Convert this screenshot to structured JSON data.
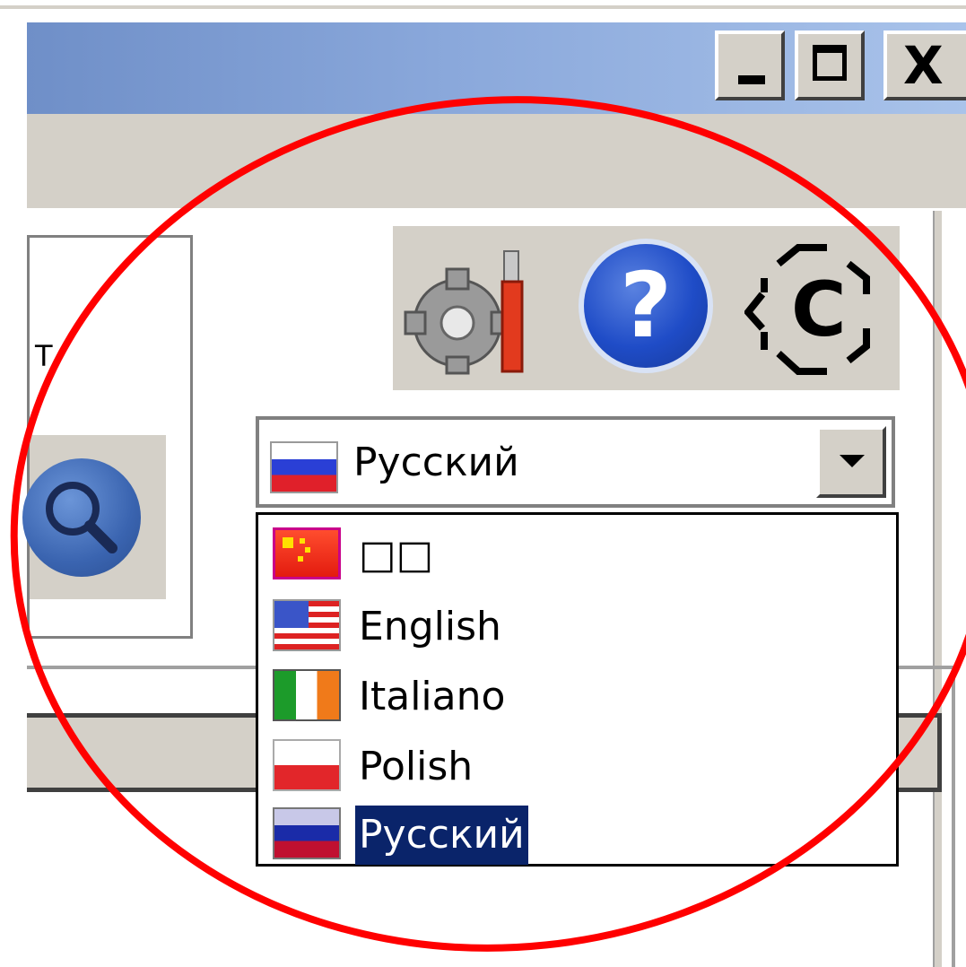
{
  "window": {
    "minimize_label": "_",
    "maximize_label": "□",
    "close_label": "X"
  },
  "left_panel": {
    "partial_text": "T"
  },
  "toolbar": {
    "icons": [
      "settings-tools-icon",
      "help-icon",
      "camera-icon"
    ],
    "help_glyph": "?",
    "camera_glyph": "C"
  },
  "language_combo": {
    "selected": "Русский",
    "selected_flag": "flag-russia-icon"
  },
  "language_list": {
    "items": [
      {
        "label": "□□",
        "flag": "flag-china-icon",
        "selected": false
      },
      {
        "label": "English",
        "flag": "flag-usa-icon",
        "selected": false
      },
      {
        "label": "Italiano",
        "flag": "flag-italy-icon",
        "selected": false
      },
      {
        "label": "Polish",
        "flag": "flag-poland-icon",
        "selected": false
      },
      {
        "label": "Русский",
        "flag": "flag-russia-icon",
        "selected": true
      }
    ]
  },
  "colors": {
    "selection": "#0a246a",
    "annotation_ellipse": "#ff0000",
    "face": "#d4d0c8"
  }
}
